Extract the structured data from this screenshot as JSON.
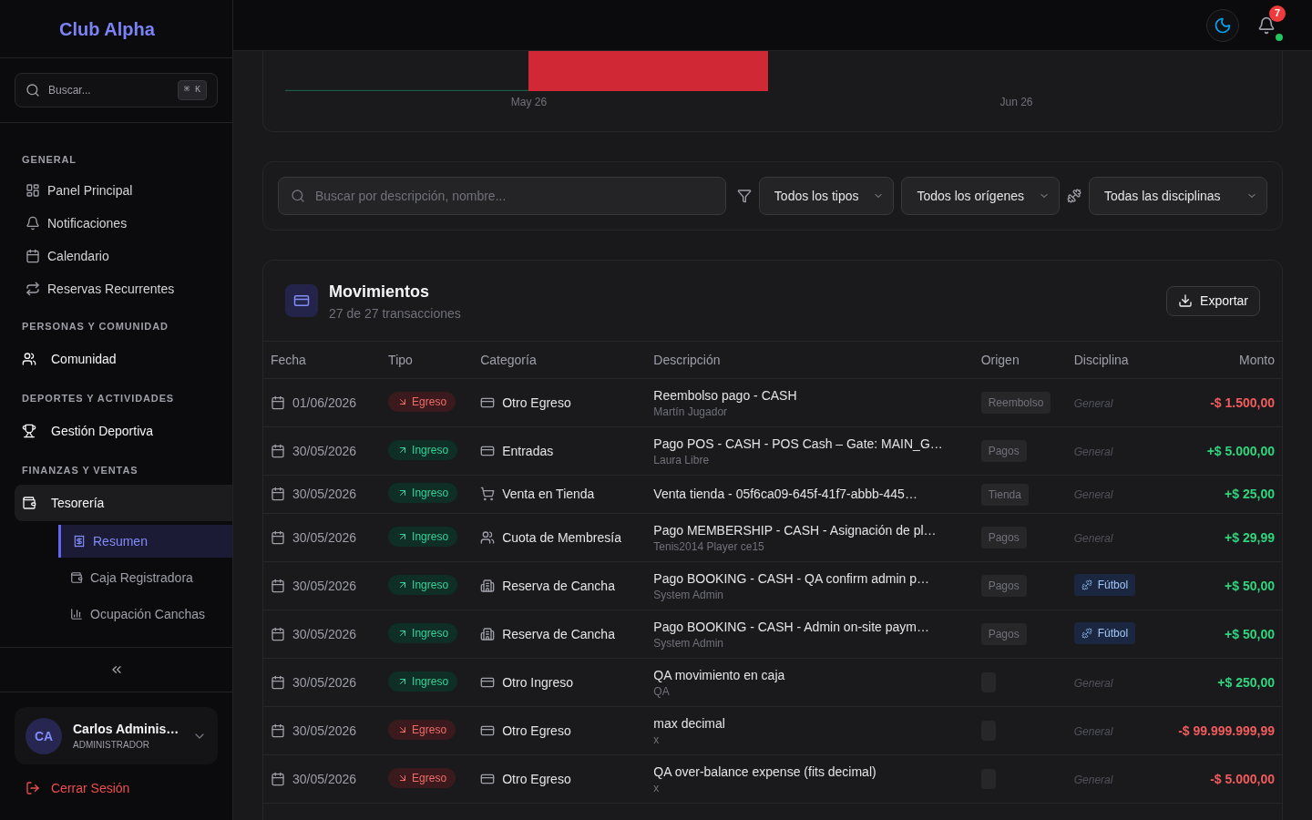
{
  "sidebar": {
    "brand": "Club Alpha",
    "search": {
      "placeholder": "Buscar...",
      "shortcut": "⌘ K"
    },
    "sections": [
      {
        "title": "GENERAL",
        "items": [
          {
            "kind": "link",
            "label": "Panel Principal",
            "selected": false
          },
          {
            "kind": "link",
            "label": "Notificaciones",
            "selected": false
          },
          {
            "kind": "link",
            "label": "Calendario",
            "selected": false
          },
          {
            "kind": "link",
            "label": "Reservas Recurrentes",
            "selected": false
          }
        ]
      },
      {
        "title": "PERSONAS Y COMUNIDAD",
        "items": [
          {
            "kind": "group",
            "label": "Comunidad",
            "expanded": false
          }
        ]
      },
      {
        "title": "DEPORTES Y ACTIVIDADES",
        "items": [
          {
            "kind": "group",
            "label": "Gestión Deportiva",
            "expanded": false
          }
        ]
      },
      {
        "title": "FINANZAS Y VENTAS",
        "items": [
          {
            "kind": "group",
            "label": "Tesorería",
            "expanded": true,
            "children": [
              {
                "label": "Resumen",
                "selected": true
              },
              {
                "label": "Caja Registradora",
                "selected": false
              },
              {
                "label": "Ocupación Canchas",
                "selected": false
              }
            ]
          }
        ]
      }
    ],
    "user": {
      "initials": "CA",
      "name": "Carlos Adminis…",
      "role": "ADMINISTRADOR"
    },
    "logout": "Cerrar Sesión"
  },
  "topbar": {
    "notifications": {
      "count": "7",
      "online": true
    }
  },
  "chart": {
    "x_labels": [
      "May 26",
      "Jun 26"
    ]
  },
  "filters": {
    "search": {
      "placeholder": "Buscar por descripción, nombre..."
    },
    "selects": [
      {
        "kind": "type",
        "value": "Todos los tipos"
      },
      {
        "kind": "origin",
        "value": "Todos los orígenes"
      },
      {
        "kind": "discipline",
        "value": "Todas las disciplinas"
      }
    ]
  },
  "movements": {
    "title": "Movimientos",
    "subtitle": "27 de 27 transacciones",
    "export_button": "Exportar",
    "columns": [
      "Fecha",
      "Tipo",
      "Categoría",
      "Descripción",
      "Origen",
      "Disciplina",
      "Monto"
    ],
    "rows": [
      {
        "date": "01/06/2026",
        "type": {
          "kind": "expense",
          "label": "Egreso"
        },
        "category": {
          "kind": "other",
          "label": "Otro Egreso"
        },
        "description": "Reembolso pago - CASH",
        "detail": "Martín Jugador",
        "origin": {
          "kind": "tag",
          "label": "Reembolso"
        },
        "discipline": {
          "kind": "general",
          "label": "General"
        },
        "amount": "-$ 1.500,00"
      },
      {
        "date": "30/05/2026",
        "type": {
          "kind": "income",
          "label": "Ingreso"
        },
        "category": {
          "kind": "tickets",
          "label": "Entradas"
        },
        "description": "Pago POS - CASH - POS Cash – Gate: MAIN_G…",
        "detail": "Laura Libre",
        "origin": {
          "kind": "tag",
          "label": "Pagos"
        },
        "discipline": {
          "kind": "general",
          "label": "General"
        },
        "amount": "+$ 5.000,00"
      },
      {
        "date": "30/05/2026",
        "type": {
          "kind": "income",
          "label": "Ingreso"
        },
        "category": {
          "kind": "store",
          "label": "Venta en Tienda"
        },
        "description": "Venta tienda - 05f6ca09-645f-41f7-abbb-445…",
        "origin": {
          "kind": "tag",
          "label": "Tienda"
        },
        "discipline": {
          "kind": "general",
          "label": "General"
        },
        "amount": "+$ 25,00"
      },
      {
        "date": "30/05/2026",
        "type": {
          "kind": "income",
          "label": "Ingreso"
        },
        "category": {
          "kind": "membership",
          "label": "Cuota de Membresía"
        },
        "description": "Pago MEMBERSHIP - CASH - Asignación de pl…",
        "detail": "Tenis2014 Player ce15",
        "origin": {
          "kind": "tag",
          "label": "Pagos"
        },
        "discipline": {
          "kind": "general",
          "label": "General"
        },
        "amount": "+$ 29,99"
      },
      {
        "date": "30/05/2026",
        "type": {
          "kind": "income",
          "label": "Ingreso"
        },
        "category": {
          "kind": "court",
          "label": "Reserva de Cancha"
        },
        "description": "Pago BOOKING - CASH - QA confirm admin p…",
        "detail": "System Admin",
        "origin": {
          "kind": "tag",
          "label": "Pagos"
        },
        "discipline": {
          "kind": "sport",
          "label": "Fútbol"
        },
        "amount": "+$ 50,00"
      },
      {
        "date": "30/05/2026",
        "type": {
          "kind": "income",
          "label": "Ingreso"
        },
        "category": {
          "kind": "court",
          "label": "Reserva de Cancha"
        },
        "description": "Pago BOOKING - CASH - Admin on-site paym…",
        "detail": "System Admin",
        "origin": {
          "kind": "tag",
          "label": "Pagos"
        },
        "discipline": {
          "kind": "sport",
          "label": "Fútbol"
        },
        "amount": "+$ 50,00"
      },
      {
        "date": "30/05/2026",
        "type": {
          "kind": "income",
          "label": "Ingreso"
        },
        "category": {
          "kind": "other",
          "label": "Otro Ingreso"
        },
        "description": "QA movimiento en caja",
        "detail": "QA",
        "origin": {
          "kind": "empty"
        },
        "discipline": {
          "kind": "general",
          "label": "General"
        },
        "amount": "+$ 250,00"
      },
      {
        "date": "30/05/2026",
        "type": {
          "kind": "expense",
          "label": "Egreso"
        },
        "category": {
          "kind": "other",
          "label": "Otro Egreso"
        },
        "description": "max decimal",
        "detail": "x",
        "origin": {
          "kind": "empty"
        },
        "discipline": {
          "kind": "general",
          "label": "General"
        },
        "amount": "-$ 99.999.999,99"
      },
      {
        "date": "30/05/2026",
        "type": {
          "kind": "expense",
          "label": "Egreso"
        },
        "category": {
          "kind": "other",
          "label": "Otro Egreso"
        },
        "description": "QA over-balance expense (fits decimal)",
        "detail": "x",
        "origin": {
          "kind": "empty"
        },
        "discipline": {
          "kind": "general",
          "label": "General"
        },
        "amount": "-$ 5.000,00"
      }
    ]
  }
}
